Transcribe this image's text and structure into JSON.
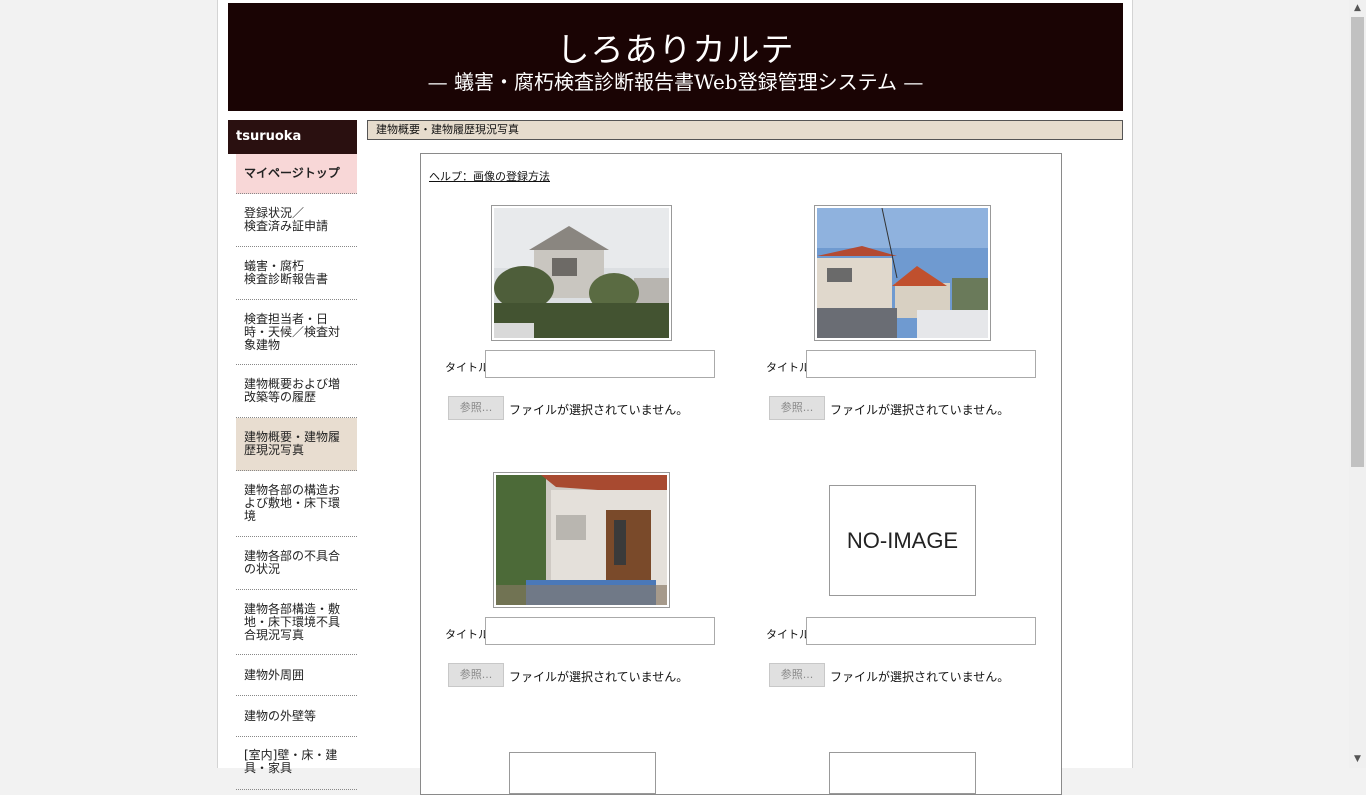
{
  "banner": {
    "title": "しろありカルテ",
    "subtitle": "— 蟻害・腐朽検査診断報告書Web登録管理システム —"
  },
  "sidebar": {
    "username": "tsuruoka",
    "items": [
      {
        "label": "マイページトップ"
      },
      {
        "label": "登録状況／\n検査済み証申請"
      },
      {
        "label": "蟻害・腐朽\n検査診断報告書"
      },
      {
        "label": "検査担当者・日時・天候／検査対象建物"
      },
      {
        "label": "建物概要および増改築等の履歴"
      },
      {
        "label": "建物概要・建物履歴現況写真"
      },
      {
        "label": "建物各部の構造および敷地・床下環境"
      },
      {
        "label": "建物各部の不具合の状況"
      },
      {
        "label": "建物各部構造・敷地・床下環境不具合現況写真"
      },
      {
        "label": "建物外周囲"
      },
      {
        "label": "建物の外壁等"
      },
      {
        "label": "[室内]壁・床・建具・家具"
      }
    ]
  },
  "content": {
    "section_title": "建物概要・建物履歴現況写真",
    "help_link": "ヘルプ：画像の登録方法",
    "title_label": "タイトル",
    "browse_label": "参照...",
    "file_status": "ファイルが選択されていません。",
    "no_image_label": "NO-IMAGE",
    "photos": [
      {
        "image": "house-photo-1",
        "title": ""
      },
      {
        "image": "house-photo-2",
        "title": ""
      },
      {
        "image": "house-photo-3",
        "title": ""
      },
      {
        "image": "no-image",
        "title": ""
      }
    ]
  },
  "colors": {
    "banner_bg": "#1a0404",
    "sidebar_header_bg": "#2a1010",
    "top_item_bg": "#f8d7d7",
    "active_item_bg": "#e8ddd0",
    "section_head_bg": "#e6dccd"
  }
}
